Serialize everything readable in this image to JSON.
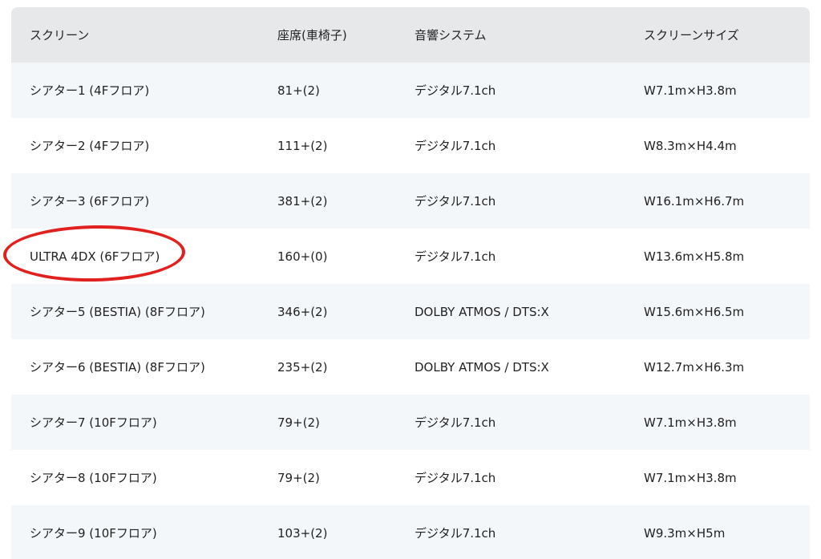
{
  "table": {
    "headers": {
      "screen": "スクリーン",
      "seats": "座席(車椅子)",
      "sound": "音響システム",
      "size": "スクリーンサイズ"
    },
    "rows": [
      {
        "screen": "シアター1 (4Fフロア)",
        "seats": "81+(2)",
        "sound": "デジタル7.1ch",
        "size": "W7.1m×H3.8m"
      },
      {
        "screen": "シアター2 (4Fフロア)",
        "seats": "111+(2)",
        "sound": "デジタル7.1ch",
        "size": "W8.3m×H4.4m"
      },
      {
        "screen": "シアター3 (6Fフロア)",
        "seats": "381+(2)",
        "sound": "デジタル7.1ch",
        "size": "W16.1m×H6.7m"
      },
      {
        "screen": "ULTRA 4DX (6Fフロア)",
        "seats": "160+(0)",
        "sound": "デジタル7.1ch",
        "size": "W13.6m×H5.8m",
        "highlighted": true
      },
      {
        "screen": "シアター5 (BESTIA) (8Fフロア)",
        "seats": "346+(2)",
        "sound": "DOLBY ATMOS / DTS:X",
        "size": "W15.6m×H6.5m"
      },
      {
        "screen": "シアター6 (BESTIA) (8Fフロア)",
        "seats": "235+(2)",
        "sound": "DOLBY ATMOS / DTS:X",
        "size": "W12.7m×H6.3m"
      },
      {
        "screen": "シアター7 (10Fフロア)",
        "seats": "79+(2)",
        "sound": "デジタル7.1ch",
        "size": "W7.1m×H3.8m"
      },
      {
        "screen": "シアター8 (10Fフロア)",
        "seats": "79+(2)",
        "sound": "デジタル7.1ch",
        "size": "W7.1m×H3.8m"
      },
      {
        "screen": "シアター9 (10Fフロア)",
        "seats": "103+(2)",
        "sound": "デジタル7.1ch",
        "size": "W9.3m×H5m"
      }
    ]
  },
  "colors": {
    "header_bg": "#e6e8ea",
    "row_alt_bg": "#f4f7fa",
    "row_bg": "#ffffff",
    "highlight": "#e0211f"
  }
}
